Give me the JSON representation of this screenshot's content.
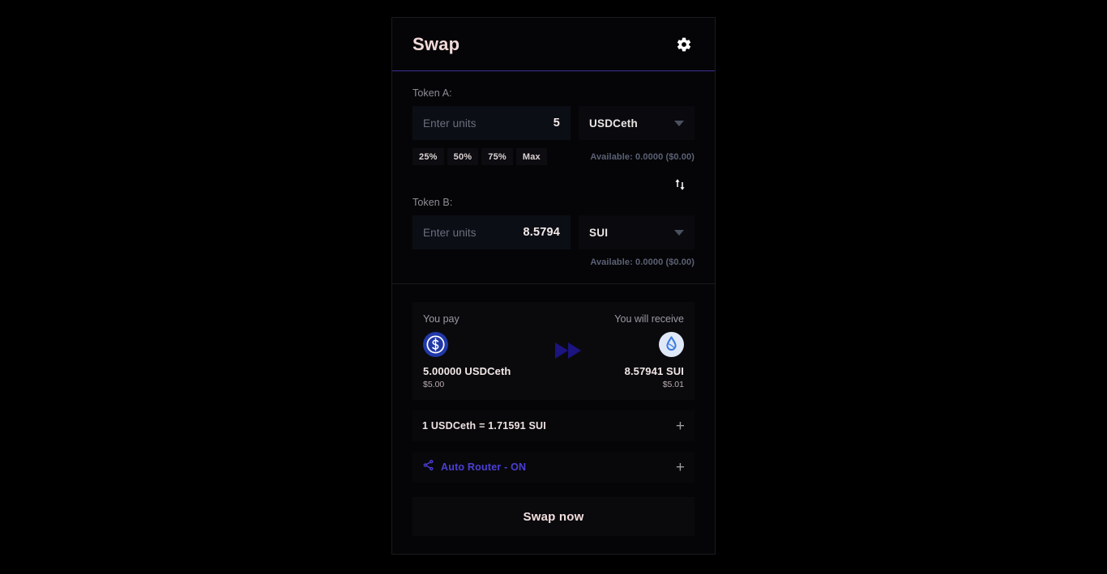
{
  "header": {
    "title": "Swap",
    "settings_icon": "gear-icon"
  },
  "token_a": {
    "label": "Token A:",
    "amount_placeholder": "Enter units",
    "amount_value": "5",
    "token_symbol": "USDCeth",
    "percent_buttons": [
      "25%",
      "50%",
      "75%",
      "Max"
    ],
    "available": "Available: 0.0000 ($0.00)"
  },
  "swap_direction": {
    "icon": "swap-vertical-icon"
  },
  "token_b": {
    "label": "Token B:",
    "amount_placeholder": "Enter units",
    "amount_value": "8.5794",
    "token_symbol": "SUI",
    "available": "Available: 0.0000 ($0.00)"
  },
  "summary": {
    "pay_label": "You pay",
    "receive_label": "You will receive",
    "pay_icon": "usdc-coin-icon",
    "pay_amount": "5.00000 USDCeth",
    "pay_usd": "$5.00",
    "arrow_icon": "fast-forward-icon",
    "receive_icon": "sui-coin-icon",
    "receive_amount": "8.57941 SUI",
    "receive_usd": "$5.01"
  },
  "rate_row": {
    "text": "1 USDCeth = 1.71591 SUI",
    "expand_icon": "plus-icon"
  },
  "router_row": {
    "icon": "share-network-icon",
    "text": "Auto Router - ON",
    "expand_icon": "plus-icon"
  },
  "action": {
    "swap_label": "Swap now"
  },
  "colors": {
    "accent": "#4b3fd4",
    "header_rule": "#3c2f96",
    "title": "#f2dada",
    "muted": "#8d8d96",
    "available": "#5b6175"
  }
}
